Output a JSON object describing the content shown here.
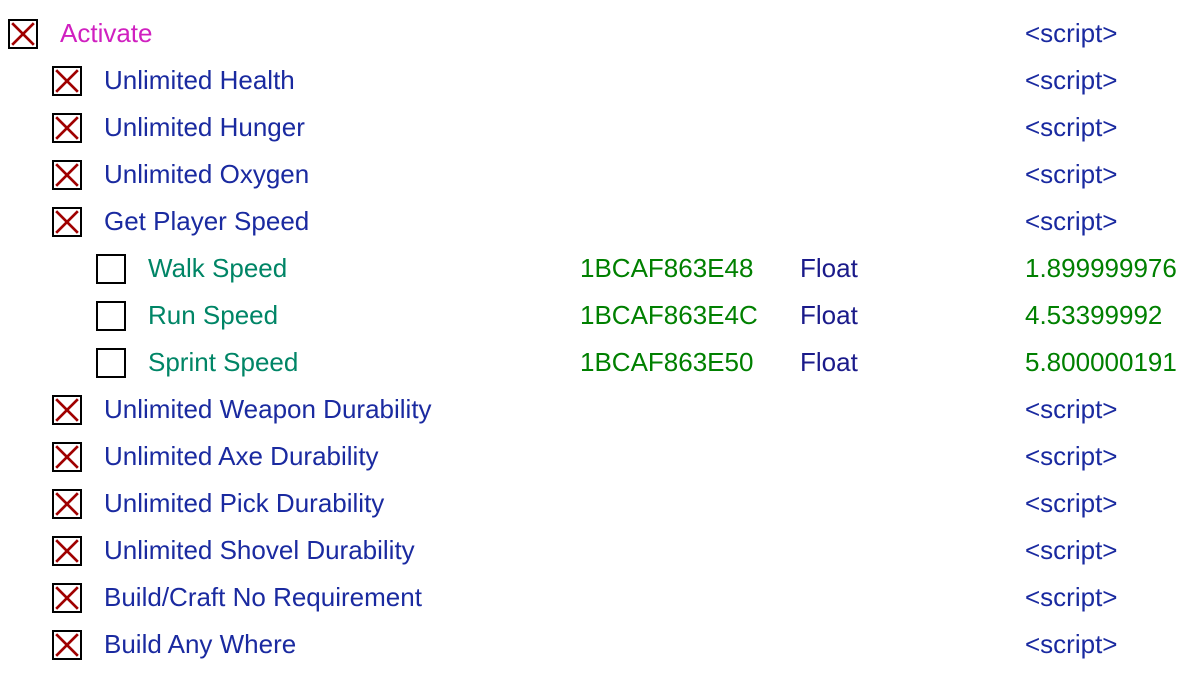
{
  "rows": [
    {
      "indent": 0,
      "checked": true,
      "label": "Activate",
      "labelClass": "txt-header",
      "addr": "",
      "type": "",
      "val": "<script>",
      "valClass": "val-script"
    },
    {
      "indent": 1,
      "checked": true,
      "label": "Unlimited Health",
      "labelClass": "txt-script",
      "addr": "",
      "type": "",
      "val": "<script>",
      "valClass": "val-script"
    },
    {
      "indent": 1,
      "checked": true,
      "label": "Unlimited Hunger",
      "labelClass": "txt-script",
      "addr": "",
      "type": "",
      "val": "<script>",
      "valClass": "val-script"
    },
    {
      "indent": 1,
      "checked": true,
      "label": "Unlimited Oxygen",
      "labelClass": "txt-script",
      "addr": "",
      "type": "",
      "val": "<script>",
      "valClass": "val-script"
    },
    {
      "indent": 1,
      "checked": true,
      "label": "Get Player Speed",
      "labelClass": "txt-script",
      "addr": "",
      "type": "",
      "val": "<script>",
      "valClass": "val-script"
    },
    {
      "indent": 2,
      "checked": false,
      "label": "Walk Speed",
      "labelClass": "txt-value",
      "addr": "1BCAF863E48",
      "type": "Float",
      "val": "1.899999976",
      "valClass": "val-num"
    },
    {
      "indent": 2,
      "checked": false,
      "label": "Run Speed",
      "labelClass": "txt-value",
      "addr": "1BCAF863E4C",
      "type": "Float",
      "val": "4.53399992",
      "valClass": "val-num"
    },
    {
      "indent": 2,
      "checked": false,
      "label": "Sprint Speed",
      "labelClass": "txt-value",
      "addr": "1BCAF863E50",
      "type": "Float",
      "val": "5.800000191",
      "valClass": "val-num"
    },
    {
      "indent": 1,
      "checked": true,
      "label": "Unlimited Weapon Durability",
      "labelClass": "txt-script",
      "addr": "",
      "type": "",
      "val": "<script>",
      "valClass": "val-script"
    },
    {
      "indent": 1,
      "checked": true,
      "label": "Unlimited Axe Durability",
      "labelClass": "txt-script",
      "addr": "",
      "type": "",
      "val": "<script>",
      "valClass": "val-script"
    },
    {
      "indent": 1,
      "checked": true,
      "label": "Unlimited Pick Durability",
      "labelClass": "txt-script",
      "addr": "",
      "type": "",
      "val": "<script>",
      "valClass": "val-script"
    },
    {
      "indent": 1,
      "checked": true,
      "label": "Unlimited Shovel Durability",
      "labelClass": "txt-script",
      "addr": "",
      "type": "",
      "val": "<script>",
      "valClass": "val-script"
    },
    {
      "indent": 1,
      "checked": true,
      "label": "Build/Craft No Requirement",
      "labelClass": "txt-script",
      "addr": "",
      "type": "",
      "val": "<script>",
      "valClass": "val-script"
    },
    {
      "indent": 1,
      "checked": true,
      "label": "Build Any Where",
      "labelClass": "txt-script",
      "addr": "",
      "type": "",
      "val": "<script>",
      "valClass": "val-script"
    }
  ]
}
